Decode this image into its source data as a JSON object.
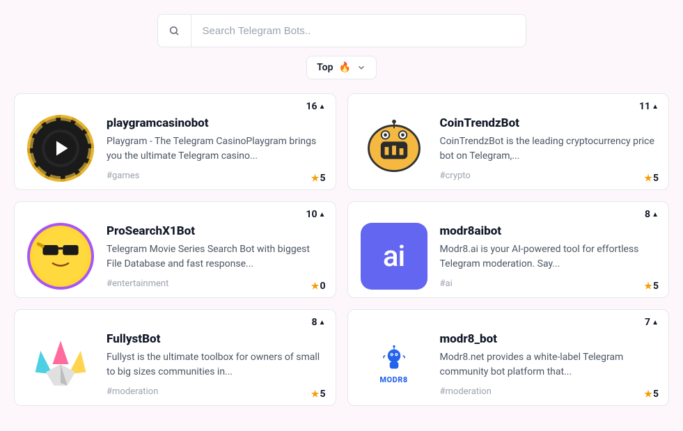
{
  "search": {
    "placeholder": "Search Telegram Bots.."
  },
  "sort": {
    "label": "Top"
  },
  "bots": [
    {
      "votes": "16",
      "name": "playgramcasinobot",
      "description": "Playgram - The Telegram CasinoPlaygram brings you the ultimate Telegram casino...",
      "tag": "#games",
      "rating": "5",
      "avatar_type": "chip"
    },
    {
      "votes": "11",
      "name": "CoinTrendzBot",
      "description": "CoinTrendzBot is the leading cryptocurrency price bot on Telegram,...",
      "tag": "#crypto",
      "rating": "5",
      "avatar_type": "robot"
    },
    {
      "votes": "10",
      "name": "ProSearchX1Bot",
      "description": "Telegram Movie Series Search Bot with biggest File Database and fast response...",
      "tag": "#entertainment",
      "rating": "0",
      "avatar_type": "emoji"
    },
    {
      "votes": "8",
      "name": "modr8aibot",
      "description": "Modr8.ai is your AI-powered tool for effortless Telegram moderation. Say...",
      "tag": "#ai",
      "rating": "5",
      "avatar_type": "ai"
    },
    {
      "votes": "8",
      "name": "FullystBot",
      "description": "Fullyst is the ultimate toolbox for owners of small to big sizes communities in...",
      "tag": "#moderation",
      "rating": "5",
      "avatar_type": "crown"
    },
    {
      "votes": "7",
      "name": "modr8_bot",
      "description": "Modr8.net provides a white-label Telegram community bot platform that...",
      "tag": "#moderation",
      "rating": "5",
      "avatar_type": "modr8"
    }
  ]
}
